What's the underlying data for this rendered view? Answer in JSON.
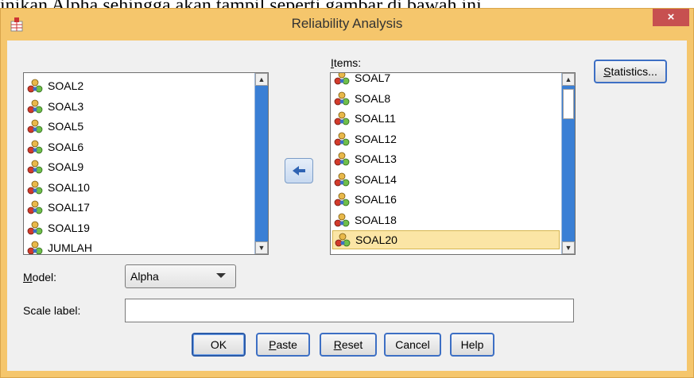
{
  "window": {
    "title": "Reliability Analysis",
    "close_label": "×"
  },
  "above_text": "inikan Alpha sehingga akan tampil seperti gambar di bawah ini.",
  "source_list": {
    "items": [
      "SOAL2",
      "SOAL3",
      "SOAL5",
      "SOAL6",
      "SOAL9",
      "SOAL10",
      "SOAL17",
      "SOAL19",
      "JUMLAH"
    ]
  },
  "items_list": {
    "label_prefix": "",
    "label_underlined": "I",
    "label_rest": "tems:",
    "items": [
      "SOAL7",
      "SOAL8",
      "SOAL11",
      "SOAL12",
      "SOAL13",
      "SOAL14",
      "SOAL16",
      "SOAL18",
      "SOAL20"
    ],
    "selected": "SOAL20"
  },
  "statistics_button": {
    "underlined": "S",
    "rest": "tatistics..."
  },
  "model": {
    "label_underlined": "M",
    "label_rest": "odel:",
    "value": "Alpha"
  },
  "scale_label": {
    "label": "Scale label:",
    "value": ""
  },
  "buttons": {
    "ok": "OK",
    "paste_underlined": "P",
    "paste_rest": "aste",
    "reset_underlined": "R",
    "reset_rest": "eset",
    "cancel": "Cancel",
    "help": "Help"
  },
  "icons": {
    "variable": "scale-variable-icon",
    "move_left": "left-arrow-icon",
    "app": "spss-table-icon"
  },
  "colors": {
    "title_bar": "#f5c66c",
    "close": "#c75050",
    "scroll_track": "#3a7fd5",
    "selected_row": "#fbe5a5"
  }
}
